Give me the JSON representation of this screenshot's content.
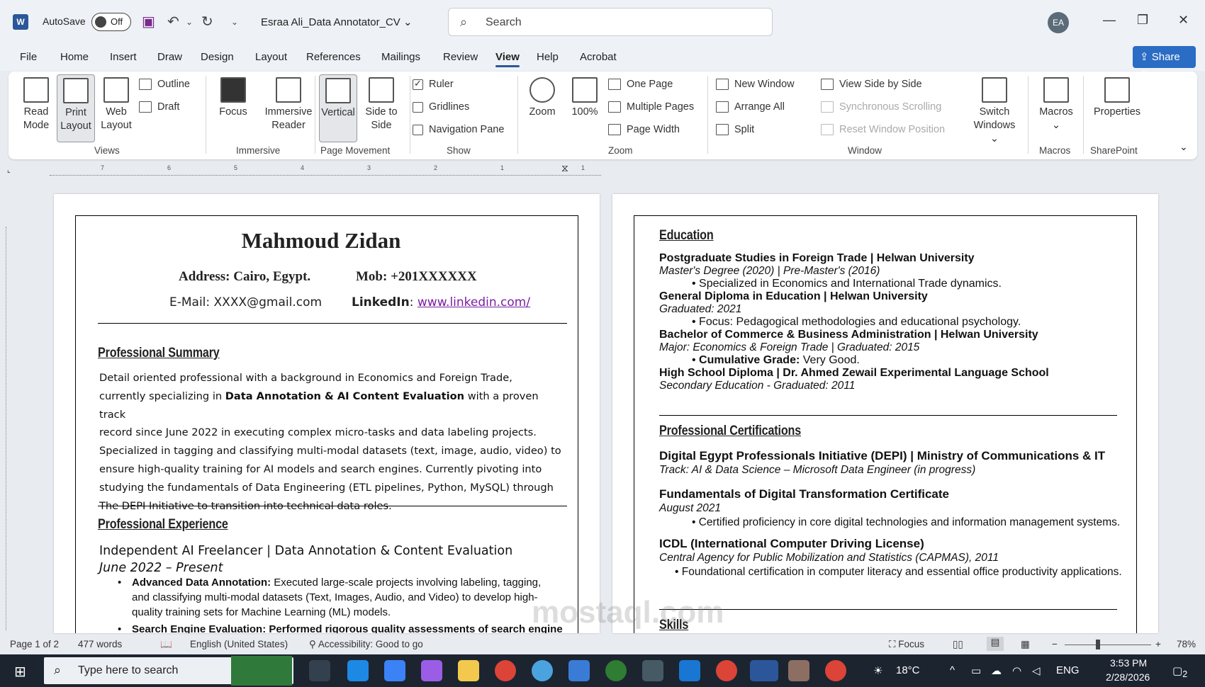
{
  "titlebar": {
    "autosave_label": "AutoSave",
    "autosave_state": "Off",
    "doc_title": "Esraa Ali_Data Annotator_CV",
    "search_placeholder": "Search",
    "avatar_initials": "EA"
  },
  "menu": {
    "tabs": [
      "File",
      "Home",
      "Insert",
      "Draw",
      "Design",
      "Layout",
      "References",
      "Mailings",
      "Review",
      "View",
      "Help",
      "Acrobat"
    ],
    "active": "View",
    "share_label": "Share"
  },
  "ribbon": {
    "views": {
      "read_mode": "Read Mode",
      "print_layout": "Print Layout",
      "web_layout": "Web Layout",
      "outline": "Outline",
      "draft": "Draft",
      "label": "Views"
    },
    "immersive": {
      "focus": "Focus",
      "immersive_reader": "Immersive Reader",
      "label": "Immersive"
    },
    "page_movement": {
      "vertical": "Vertical",
      "side_to_side": "Side to Side",
      "label": "Page Movement"
    },
    "show": {
      "ruler": "Ruler",
      "gridlines": "Gridlines",
      "navigation_pane": "Navigation Pane",
      "label": "Show"
    },
    "zoom": {
      "zoom": "Zoom",
      "hundred": "100%",
      "one_page": "One Page",
      "multiple_pages": "Multiple Pages",
      "page_width": "Page Width",
      "label": "Zoom"
    },
    "window": {
      "new_window": "New Window",
      "arrange_all": "Arrange All",
      "split": "Split",
      "view_side_by_side": "View Side by Side",
      "sync_scrolling": "Synchronous Scrolling",
      "reset_window": "Reset Window Position",
      "switch_windows": "Switch Windows",
      "label": "Window"
    },
    "macros": {
      "macros": "Macros",
      "label": "Macros"
    },
    "sharepoint": {
      "properties": "Properties",
      "label": "SharePoint"
    }
  },
  "ruler_numbers": [
    "7",
    "6",
    "5",
    "4",
    "3",
    "2",
    "1",
    "1"
  ],
  "page1": {
    "name": "Mahmoud Zidan",
    "address": "Address: Cairo, Egypt.",
    "mobile": "Mob: +201XXXXXX",
    "email": "E-Mail: XXXX@gmail.com",
    "linkedin_label": "LinkedIn",
    "linkedin_url": "www.linkedin.com/",
    "summary_heading": "Professional Summary",
    "summary_lines": [
      "Detail oriented professional with a background in Economics and Foreign Trade,",
      "currently specializing in",
      "Data Annotation & AI Content Evaluation",
      "with a proven track",
      "record since June 2022 in executing complex micro-tasks and data labeling projects.",
      "Specialized in tagging and classifying multi-modal datasets (text, image, audio, video) to",
      "ensure high-quality training for AI models and search engines. Currently pivoting into",
      "studying the fundamentals of Data Engineering (ETL pipelines, Python, MySQL) through",
      "The DEPI Initiative to transition into technical data roles."
    ],
    "experience_heading": "Professional Experience",
    "job_title": "Independent AI Freelancer | Data Annotation & Content Evaluation",
    "job_dates": "June 2022 – Present",
    "bullet1_bold": "Advanced Data Annotation:",
    "bullet1_rest": " Executed large-scale projects involving labeling, tagging,",
    "bullet1_line2": "and classifying multi-modal datasets (Text, Images, Audio, and Video) to develop high-",
    "bullet1_line3": "quality training sets for Machine Learning (ML) models.",
    "bullet2_partial": "Search Engine Evaluation: Performed rigorous quality assessments of search engine"
  },
  "page2": {
    "education_heading": "Education",
    "edu": [
      {
        "title": "Postgraduate Studies in Foreign Trade | Helwan University",
        "sub": "Master's Degree (2020) | Pre-Master's (2016)",
        "bullet_bold": "",
        "bullet": "Specialized in Economics and International Trade dynamics."
      },
      {
        "title": "General Diploma in Education | Helwan University",
        "sub": "Graduated: 2021",
        "bullet_bold": "",
        "bullet": "Focus: Pedagogical methodologies and educational psychology."
      },
      {
        "title": "Bachelor of Commerce & Business Administration | Helwan University",
        "sub": "Major: Economics & Foreign Trade | Graduated: 2015",
        "bullet_bold": "Cumulative Grade:",
        "bullet": " Very Good."
      },
      {
        "title": "High School Diploma | Dr. Ahmed Zewail Experimental Language School",
        "sub": "Secondary Education - Graduated: 2011",
        "bullet_bold": "",
        "bullet": ""
      }
    ],
    "cert_heading": "Professional Certifications",
    "certs": [
      {
        "title": "Digital Egypt Professionals Initiative (DEPI) | Ministry of Communications & IT",
        "sub": "Track: AI & Data Science – Microsoft Data Engineer (in progress)",
        "bullet": ""
      },
      {
        "title": "Fundamentals of Digital Transformation Certificate",
        "sub": "August 2021",
        "bullet": "Certified proficiency in core digital technologies and information management systems."
      },
      {
        "title": "ICDL (International Computer Driving License)",
        "sub": "Central Agency for Public Mobilization and Statistics (CAPMAS), 2011",
        "bullet": "Foundational certification in computer literacy and essential office productivity applications."
      }
    ],
    "skills_heading": "Skills"
  },
  "statusbar": {
    "page": "Page 1 of 2",
    "words": "477 words",
    "language": "English (United States)",
    "accessibility": "Accessibility: Good to go",
    "focus": "Focus",
    "zoom": "78%"
  },
  "taskbar": {
    "search_placeholder": "Type here to search",
    "temperature": "18°C",
    "lang": "ENG",
    "time": "3:53 PM",
    "date": "2/28/2026",
    "notifications": "2"
  },
  "watermark": "mostaql.com"
}
